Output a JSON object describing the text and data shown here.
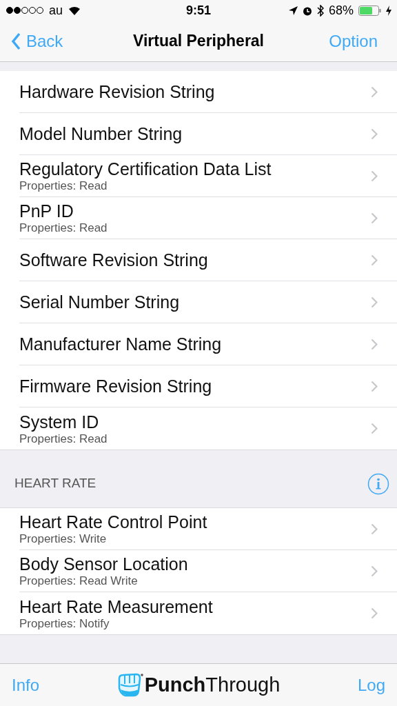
{
  "status_bar": {
    "carrier": "au",
    "time": "9:51",
    "battery": "68%"
  },
  "nav_bar": {
    "back": "Back",
    "title": "Virtual Peripheral",
    "action": "Option"
  },
  "sections": [
    {
      "items": [
        {
          "title": "Hardware Revision String"
        },
        {
          "title": "Model Number String"
        },
        {
          "title": "Regulatory Certification Data List",
          "subtitle": "Properties: Read"
        },
        {
          "title": "PnP ID",
          "subtitle": "Properties: Read"
        },
        {
          "title": "Software Revision String"
        },
        {
          "title": "Serial Number String"
        },
        {
          "title": "Manufacturer Name String"
        },
        {
          "title": "Firmware Revision String"
        },
        {
          "title": "System ID",
          "subtitle": "Properties: Read"
        }
      ]
    },
    {
      "header": "HEART RATE",
      "items": [
        {
          "title": "Heart Rate Control Point",
          "subtitle": "Properties: Write"
        },
        {
          "title": "Body Sensor Location",
          "subtitle": "Properties: Read Write"
        },
        {
          "title": "Heart Rate Measurement",
          "subtitle": "Properties: Notify"
        }
      ]
    }
  ],
  "tab_bar": {
    "left": "Info",
    "logo": "**Punch**Through",
    "right": "Log"
  }
}
